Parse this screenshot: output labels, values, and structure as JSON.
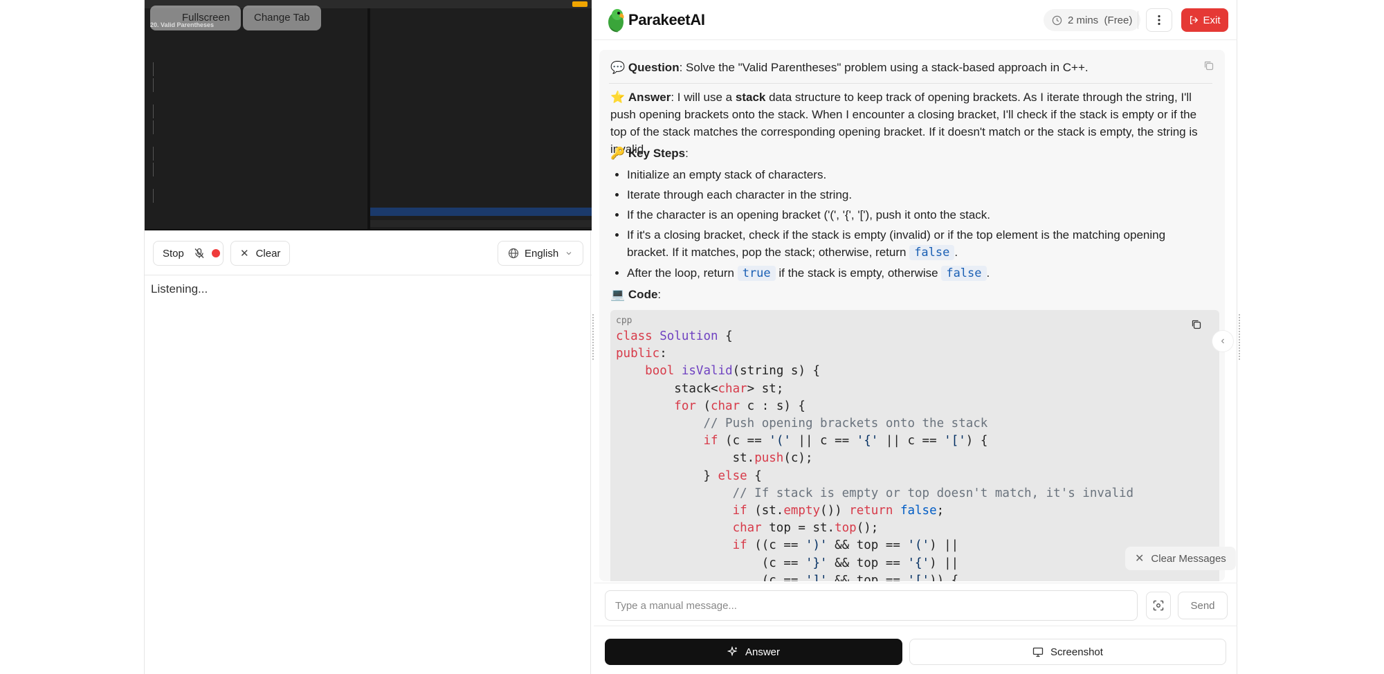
{
  "preview": {
    "fullscreen_label": "Fullscreen",
    "change_tab_label": "Change Tab",
    "problem_title": "20. Valid Parentheses"
  },
  "controls": {
    "stop_label": "Stop",
    "clear_label": "Clear",
    "language_label": "English",
    "status_text": "Listening..."
  },
  "header": {
    "brand": "ParakeetAI",
    "timer": "2 mins",
    "plan": "(Free)",
    "exit_label": "Exit"
  },
  "chat": {
    "question_label": "Question",
    "question_text": ": Solve the \"Valid Parentheses\" problem using a stack-based approach in C++.",
    "answer_label": "Answer",
    "answer_text_1": ": I will use a ",
    "answer_bold": "stack",
    "answer_text_2": " data structure to keep track of opening brackets. As I iterate through the string, I'll push opening brackets onto the stack. When I encounter a closing bracket, I'll check if the stack is empty or if the top of the stack matches the corresponding opening bracket. If it doesn't match or the stack is empty, the string is invalid.",
    "key_steps_label": "Key Steps",
    "steps": {
      "s1": "Initialize an empty stack of characters.",
      "s2": "Iterate through each character in the string.",
      "s3": "If the character is an opening bracket ('(', '{', '['), push it onto the stack.",
      "s4a": "If it's a closing bracket, check if the stack is empty (invalid) or if the top element is the matching opening bracket. If it matches, pop the stack; otherwise, return ",
      "s4b": ".",
      "s5a": "After the loop, return ",
      "s5b": " if the stack is empty, otherwise ",
      "s5c": ".",
      "false_kw": "false",
      "true_kw": "true"
    },
    "code_label": "Code",
    "code_lang": "cpp",
    "clear_messages_label": "Clear Messages"
  },
  "input": {
    "placeholder": "Type a manual message...",
    "send_label": "Send"
  },
  "actions": {
    "answer_label": "Answer",
    "screenshot_label": "Screenshot"
  },
  "icons": {
    "question": "speech-bubble-icon",
    "answer": "star-icon",
    "key_steps": "key-icon",
    "code": "laptop-icon"
  },
  "colors": {
    "exit": "#e53935",
    "answer_button": "#111111",
    "recording_dot": "#ef3b3b"
  }
}
